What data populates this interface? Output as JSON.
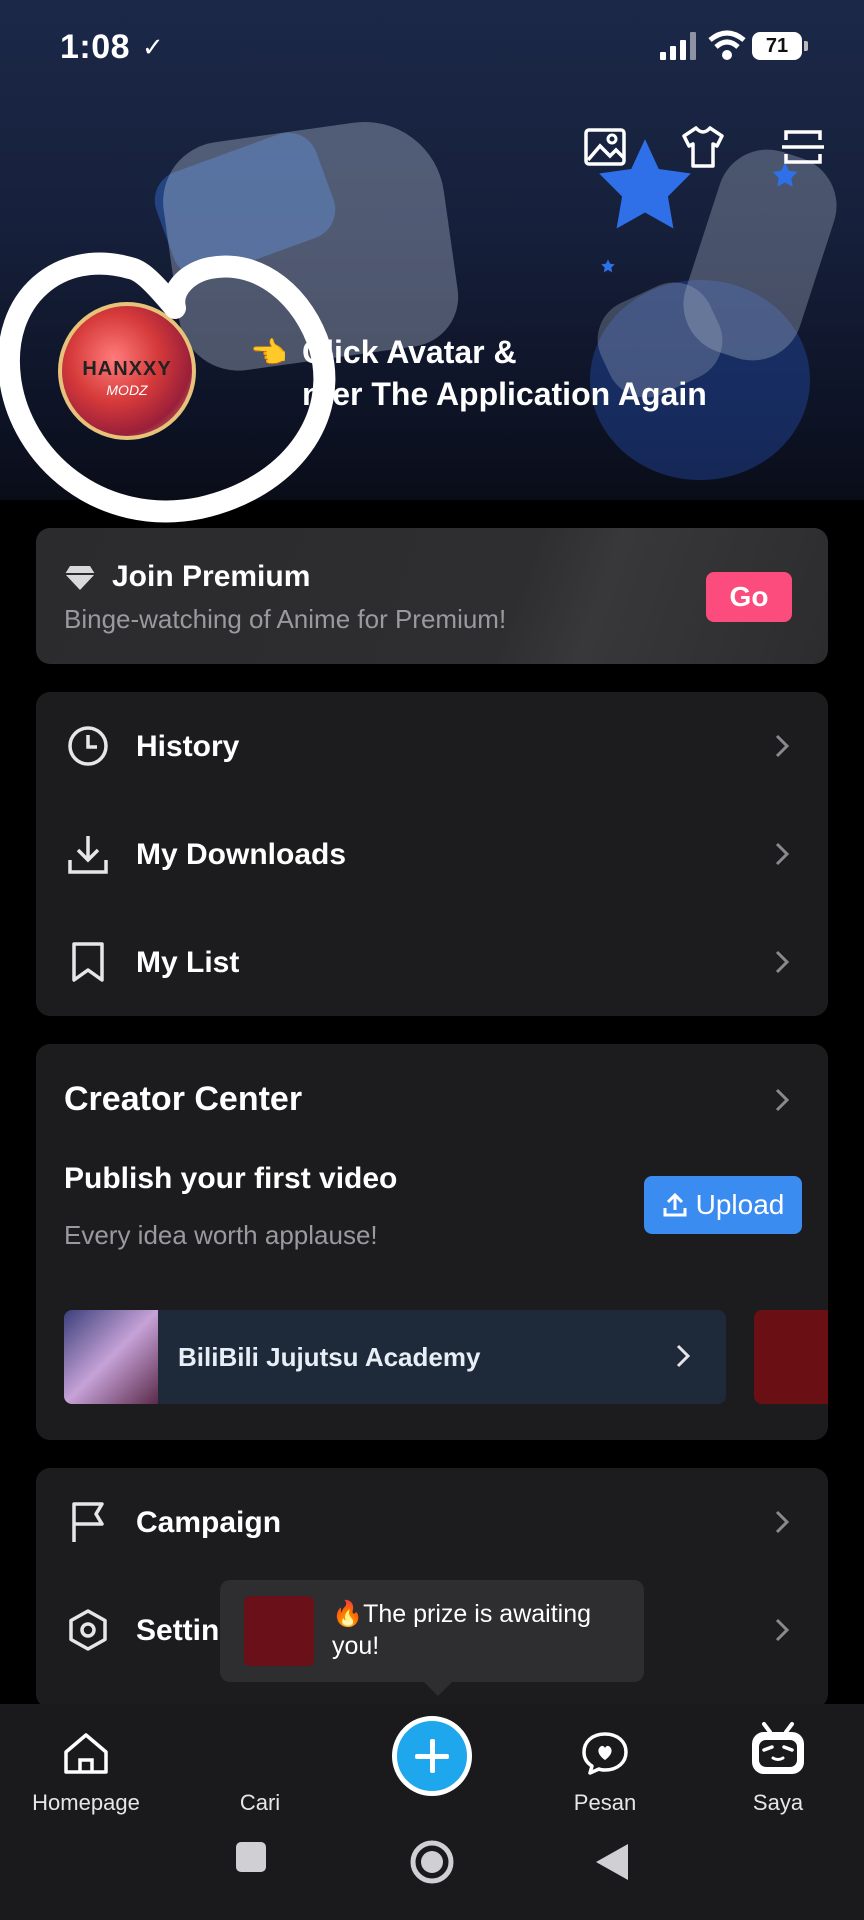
{
  "status_bar": {
    "time": "1:08",
    "battery": "71"
  },
  "header": {
    "avatar_name": "HANXXY",
    "avatar_sub": "MODZ",
    "promo_line1": "Click Avatar &",
    "promo_line2": "nter The Application Again",
    "icons": [
      "image-icon",
      "shirt-icon",
      "scan-icon"
    ]
  },
  "premium": {
    "title": "Join Premium",
    "subtitle": "Binge-watching of Anime for Premium!",
    "button": "Go"
  },
  "menu": {
    "items": [
      {
        "label": "History",
        "icon": "clock-icon"
      },
      {
        "label": "My Downloads",
        "icon": "download-icon"
      },
      {
        "label": "My List",
        "icon": "bookmark-icon"
      }
    ]
  },
  "creator": {
    "title": "Creator Center",
    "publish_title": "Publish your first video",
    "publish_sub": "Every idea worth applause!",
    "upload": "Upload",
    "academy": "BiliBili Jujutsu Academy"
  },
  "menu2": {
    "items": [
      {
        "label": "Campaign",
        "icon": "flag-icon"
      },
      {
        "label": "Settin",
        "icon": "settings-icon"
      }
    ]
  },
  "toast": {
    "text": "🔥The prize is awaiting you!"
  },
  "bottom_nav": {
    "items": [
      {
        "label": "Homepage",
        "icon": "home-icon"
      },
      {
        "label": "Cari",
        "icon": "search-icon"
      },
      {
        "label": "Pesan",
        "icon": "message-icon"
      },
      {
        "label": "Saya",
        "icon": "profile-icon"
      }
    ]
  },
  "colors": {
    "accent_pink": "#fb4c7d",
    "accent_blue": "#3a8cf0",
    "plus_blue": "#1fa7ee"
  }
}
